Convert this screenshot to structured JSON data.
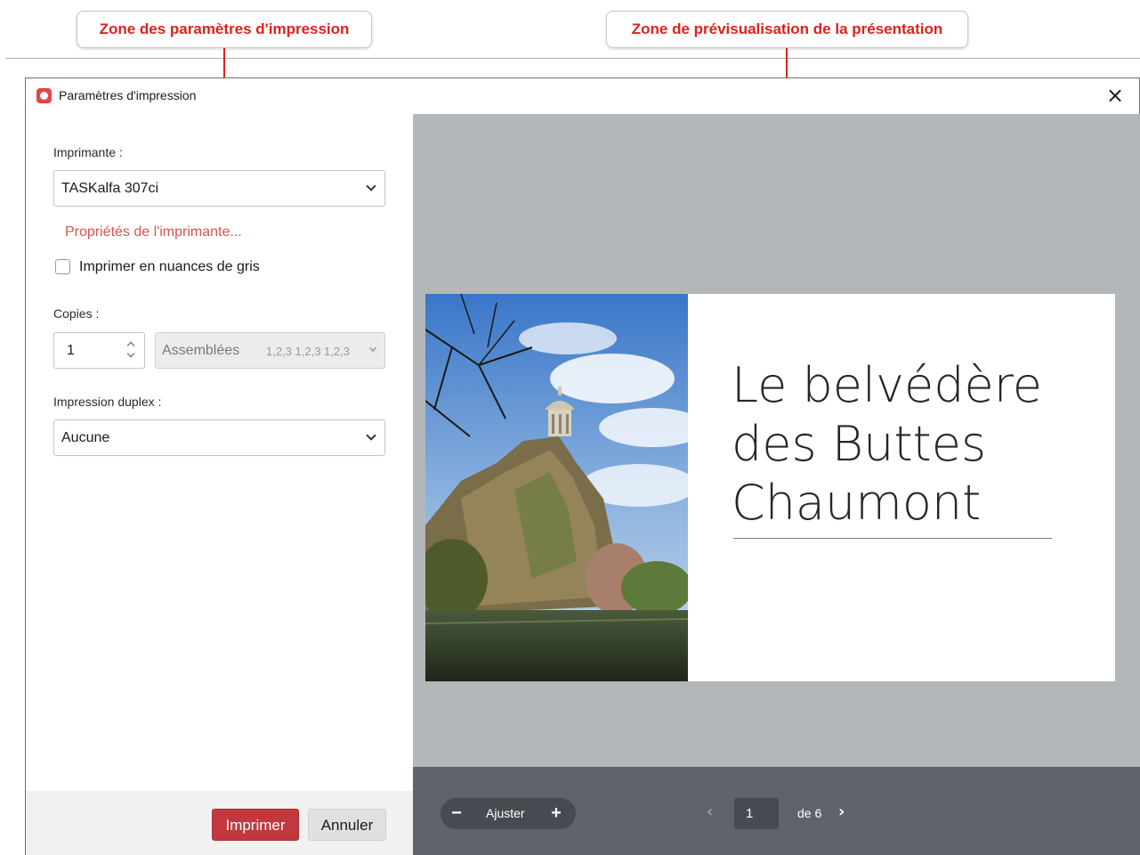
{
  "annotations": {
    "settings_zone": "Zone des paramètres d'impression",
    "preview_zone": "Zone de prévisualisation de la présentation"
  },
  "dialog": {
    "title": "Paramètres d'impression",
    "close_icon": "close-icon"
  },
  "settings": {
    "printer_label": "Imprimante :",
    "printer_value": "TASKalfa 307ci",
    "printer_properties_link": "Propriétés de l'imprimante...",
    "grayscale_label": "Imprimer en nuances de gris",
    "grayscale_checked": false,
    "copies_label": "Copies :",
    "copies_value": "1",
    "collate_value": "Assemblées",
    "collate_sequence": "1,2,3 1,2,3 1,2,3",
    "duplex_label": "Impression duplex :",
    "duplex_value": "Aucune"
  },
  "buttons": {
    "print": "Imprimer",
    "cancel": "Annuler"
  },
  "preview": {
    "slide_title_line1": "Le belvédère",
    "slide_title_line2": "des Buttes",
    "slide_title_line3": "Chaumont",
    "zoom_minus": "−",
    "zoom_label": "Ajuster",
    "zoom_plus": "+",
    "current_page": "1",
    "page_total_label": "de 6"
  },
  "colors": {
    "accent": "#c1393f",
    "annotation": "#e0201b",
    "link": "#d9534f",
    "preview_bg": "#b4b7ba",
    "preview_bar": "#5e6469"
  }
}
